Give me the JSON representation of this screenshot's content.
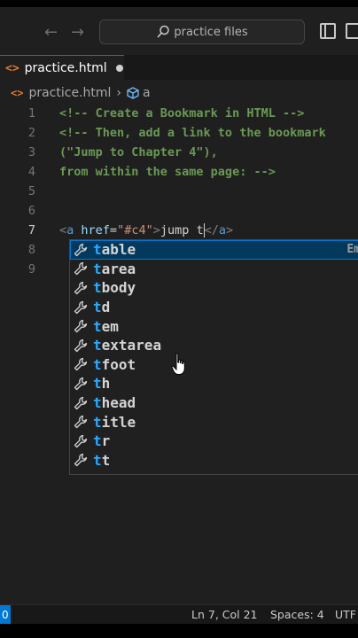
{
  "window": {
    "search_placeholder": "practice files",
    "back_icon": "arrow-left-icon",
    "forward_icon": "arrow-right-icon"
  },
  "tab": {
    "file_name": "practice.html",
    "modified": true
  },
  "breadcrumb": {
    "file": "practice.html",
    "symbol": "a"
  },
  "editor": {
    "line_numbers": [
      "1",
      "2",
      "3",
      "4",
      "5",
      "6",
      "7",
      "8",
      "9"
    ],
    "active_line": "7",
    "lines": {
      "l1": "<!-- Create a Bookmark in HTML -->",
      "l2": "<!-- Then, add a link to the bookmark",
      "l3": "(\"Jump to Chapter 4\"),",
      "l4": "from within the same page: -->",
      "l7_open_bracket": "<",
      "l7_tag": "a",
      "l7_attr": " href",
      "l7_eq": "=",
      "l7_value": "\"#c4\"",
      "l7_gt": ">",
      "l7_text": "jump t",
      "l7_close": "</",
      "l7_close_tag": "a",
      "l7_close_gt": ">"
    }
  },
  "suggestions": {
    "typed_prefix": "t",
    "items": [
      {
        "rest": "able",
        "detail": "Em"
      },
      {
        "rest": "area",
        "detail": ""
      },
      {
        "rest": "body",
        "detail": ""
      },
      {
        "rest": "d",
        "detail": ""
      },
      {
        "rest": "em",
        "detail": ""
      },
      {
        "rest": "extarea",
        "detail": ""
      },
      {
        "rest": "foot",
        "detail": ""
      },
      {
        "rest": "h",
        "detail": ""
      },
      {
        "rest": "head",
        "detail": ""
      },
      {
        "rest": "itle",
        "detail": ""
      },
      {
        "rest": "r",
        "detail": ""
      },
      {
        "rest": "t",
        "detail": ""
      }
    ],
    "icon": "wrench-icon",
    "selected_index": 0
  },
  "statusbar": {
    "remote": "0",
    "position": "Ln 7, Col 21",
    "spaces": "Spaces: 4",
    "encoding": "UTF"
  },
  "colors": {
    "accent": "#0078d4",
    "match": "#2aaaff",
    "comment": "#6a9955"
  }
}
